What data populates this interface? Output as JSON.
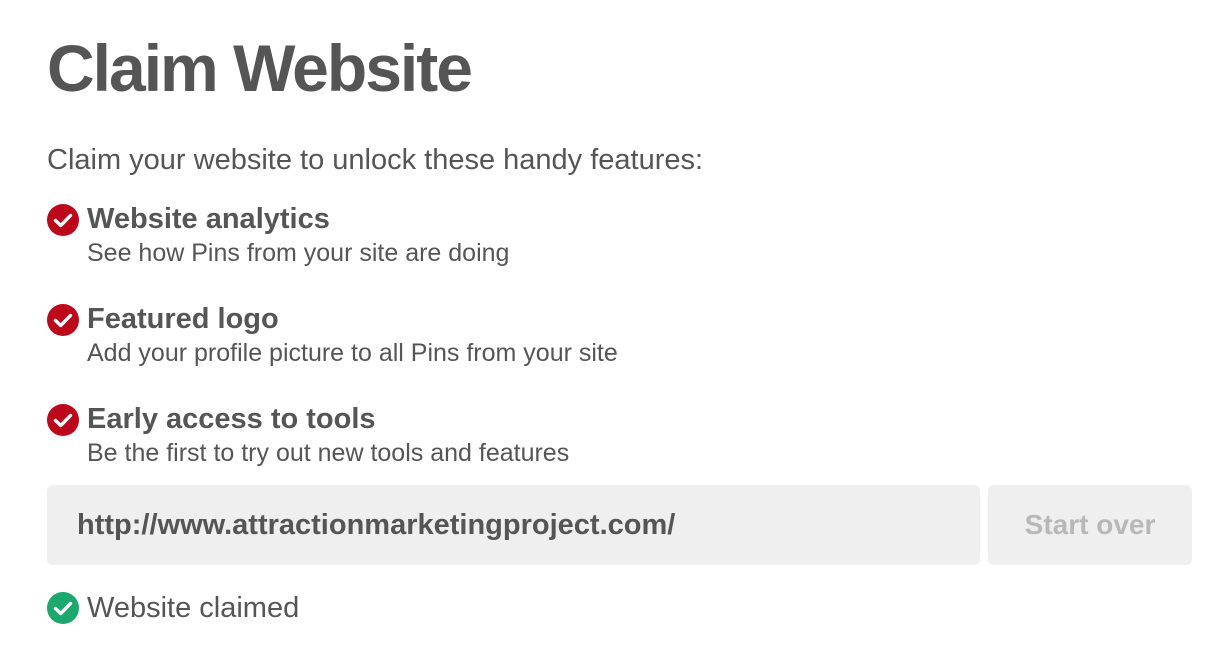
{
  "page": {
    "title": "Claim Website",
    "intro": "Claim your website to unlock these handy features:"
  },
  "features": [
    {
      "icon": "check-circle-icon",
      "title": "Website analytics",
      "description": "See how Pins from your site are doing"
    },
    {
      "icon": "check-circle-icon",
      "title": "Featured logo",
      "description": "Add your profile picture to all Pins from your site"
    },
    {
      "icon": "check-circle-icon",
      "title": "Early access to tools",
      "description": "Be the first to try out new tools and features"
    }
  ],
  "website": {
    "value": "http://www.attractionmarketingproject.com/",
    "start_over_label": "Start over"
  },
  "status": {
    "icon": "green-check-circle-icon",
    "text": "Website claimed"
  },
  "colors": {
    "feature_check": "#bd081c",
    "claimed_check": "#1aa86c",
    "text": "#555555",
    "field_background": "#efefef",
    "disabled_text": "#b8b8b8"
  }
}
